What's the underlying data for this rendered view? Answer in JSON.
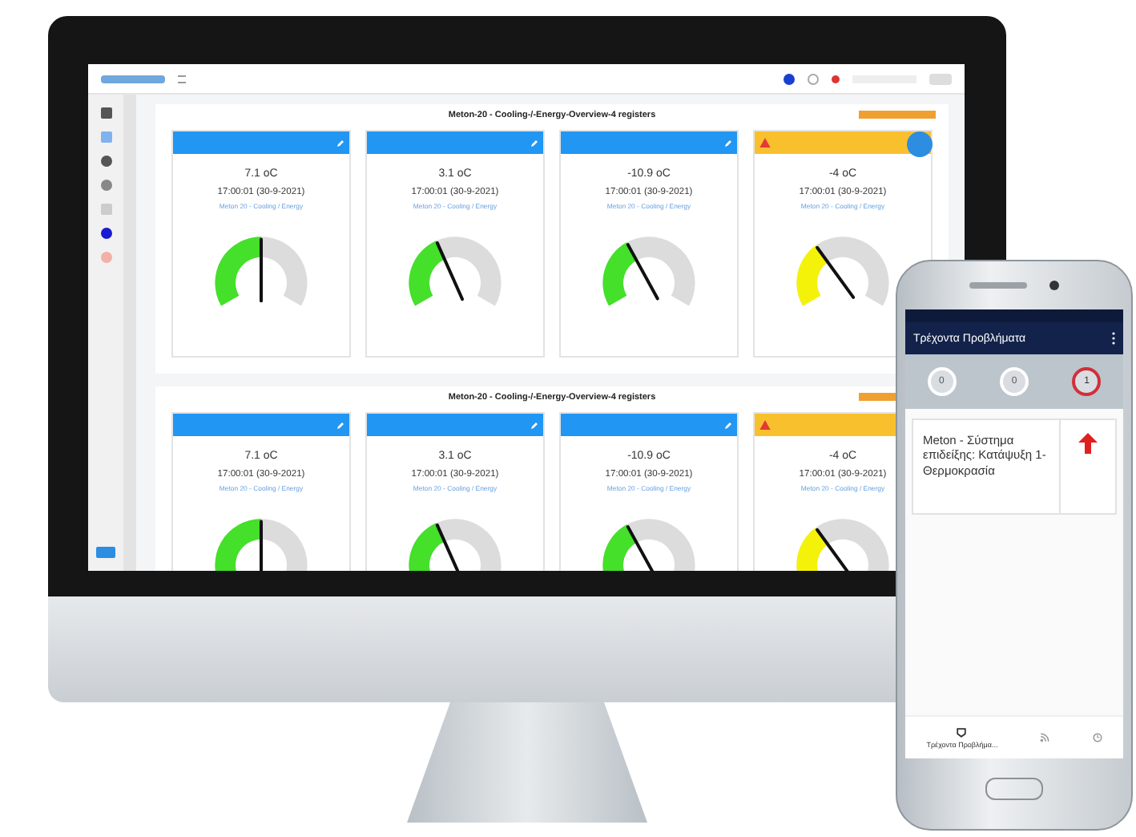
{
  "dashboard": {
    "sections": [
      {
        "title": "Meton-20 - Cooling-/-Energy-Overview-4 registers",
        "cards": [
          {
            "warning": false,
            "value": "7.1 oC",
            "timestamp": "17:00:01 (30-9-2021)",
            "source": "Meton 20 - Cooling / Energy",
            "level": 0.5
          },
          {
            "warning": false,
            "value": "3.1 oC",
            "timestamp": "17:00:01 (30-9-2021)",
            "source": "Meton 20 - Cooling / Energy",
            "level": 0.4
          },
          {
            "warning": false,
            "value": "-10.9 oC",
            "timestamp": "17:00:01 (30-9-2021)",
            "source": "Meton 20 - Cooling / Energy",
            "level": 0.38
          },
          {
            "warning": true,
            "value": "-4 oC",
            "timestamp": "17:00:01 (30-9-2021)",
            "source": "Meton 20 - Cooling / Energy",
            "level": 0.35
          }
        ]
      },
      {
        "title": "Meton-20 - Cooling-/-Energy-Overview-4 registers",
        "cards": [
          {
            "warning": false,
            "value": "7.1 oC",
            "timestamp": "17:00:01 (30-9-2021)",
            "source": "Meton 20 - Cooling / Energy",
            "level": 0.5
          },
          {
            "warning": false,
            "value": "3.1 oC",
            "timestamp": "17:00:01 (30-9-2021)",
            "source": "Meton 20 - Cooling / Energy",
            "level": 0.4
          },
          {
            "warning": false,
            "value": "-10.9 oC",
            "timestamp": "17:00:01 (30-9-2021)",
            "source": "Meton 20 - Cooling / Energy",
            "level": 0.38
          },
          {
            "warning": true,
            "value": "-4 oC",
            "timestamp": "17:00:01 (30-9-2021)",
            "source": "Meton 20 - Cooling / Energy",
            "level": 0.35
          }
        ]
      }
    ]
  },
  "phone": {
    "title": "Τρέχοντα Προβλήματα",
    "counters": [
      {
        "value": "0",
        "alert": false
      },
      {
        "value": "0",
        "alert": false
      },
      {
        "value": "1",
        "alert": true
      }
    ],
    "problems": [
      {
        "text": "Meton - Σύστημα επιδείξης: Κατάψυξη 1-Θερμοκρασία"
      }
    ],
    "nav": [
      {
        "label": "Τρέχοντα Προβλήμα...",
        "selected": true
      }
    ]
  }
}
